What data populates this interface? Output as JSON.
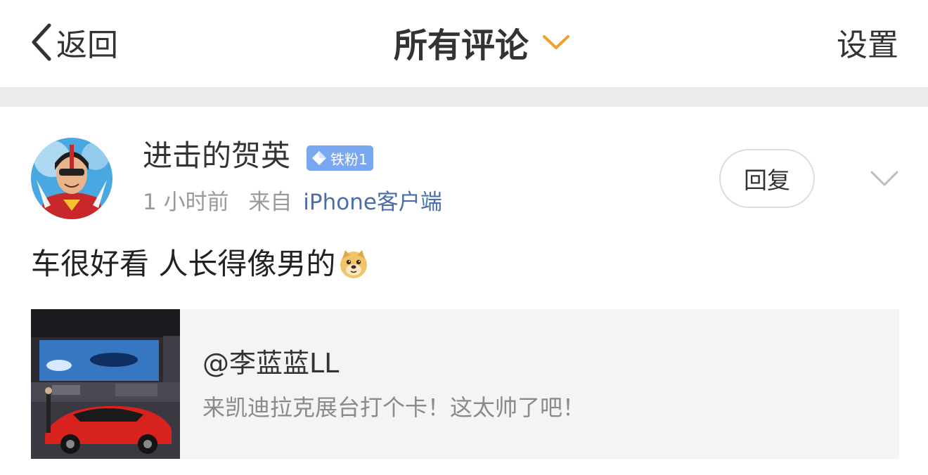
{
  "header": {
    "back_label": "返回",
    "title": "所有评论",
    "settings_label": "设置"
  },
  "comment": {
    "username": "进击的贺英",
    "badge": "铁粉1",
    "time": "1 小时前",
    "source_label": "来自",
    "client": "iPhone客户端",
    "reply_label": "回复",
    "text": "车很好看 人长得像男的"
  },
  "quoted_post": {
    "author": "@李蓝蓝LL",
    "text": "来凯迪拉克展台打个卡！这太帅了吧！"
  },
  "colors": {
    "accent_chevron": "#f0a030",
    "badge_bg": "#7aa8f0",
    "link": "#4a6fa8",
    "meta": "#9a9a9a",
    "quote_bg": "#f4f4f4"
  },
  "icons": {
    "back": "back-chevron-icon",
    "title_dropdown": "chevron-down-icon",
    "more": "chevron-down-icon",
    "badge": "diamond-icon",
    "emoji": "doge-emoji-icon"
  }
}
